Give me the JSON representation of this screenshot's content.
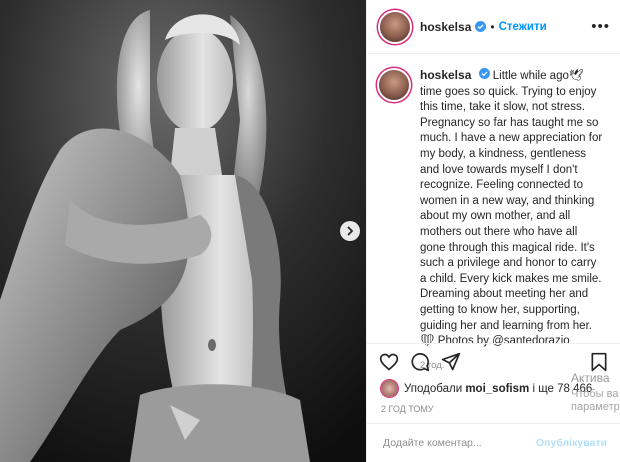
{
  "post": {
    "username": "hoskelsa",
    "follow_label": "Стежити",
    "dot": "•",
    "more": "•••",
    "caption": "Little while ago🕊 time goes so quick. Trying to enjoy this time, take it slow, not stress. Pregnancy so far has taught me so much. I have a new appreciation for my body, a kindness, gentleness and love towards myself I don't recognize. Feeling connected to women in a new way, and thinking about my own mother, and all mothers out there who have all gone through this magical ride. It's such a privilege and honor to carry a child. Every kick makes me smile. Dreaming about meeting her and getting to know her, supporting, guiding her and learning from her. ❤ Photos by @santedorazio",
    "caption_time": "2 год.",
    "likes_prefix": "Уподобали",
    "likes_user": "moi_sofism",
    "likes_suffix": "і ще 78 466",
    "post_time": "2 ГОД ТОМУ",
    "comment_placeholder": "Додайте коментар...",
    "publish_label": "Опублікувати"
  },
  "overlay": {
    "activate_title": "Актива",
    "activate_line1": "Чтобы ва",
    "activate_line2": "параметр"
  },
  "icons": {
    "verified": "verified-badge-icon",
    "next": "chevron-right-icon",
    "like": "heart-icon",
    "comment": "comment-bubble-icon",
    "share": "paper-plane-icon",
    "save": "bookmark-icon"
  },
  "colors": {
    "accent": "#0095f6",
    "story_ring": "#d92e7c",
    "heart": "#e0245e"
  }
}
